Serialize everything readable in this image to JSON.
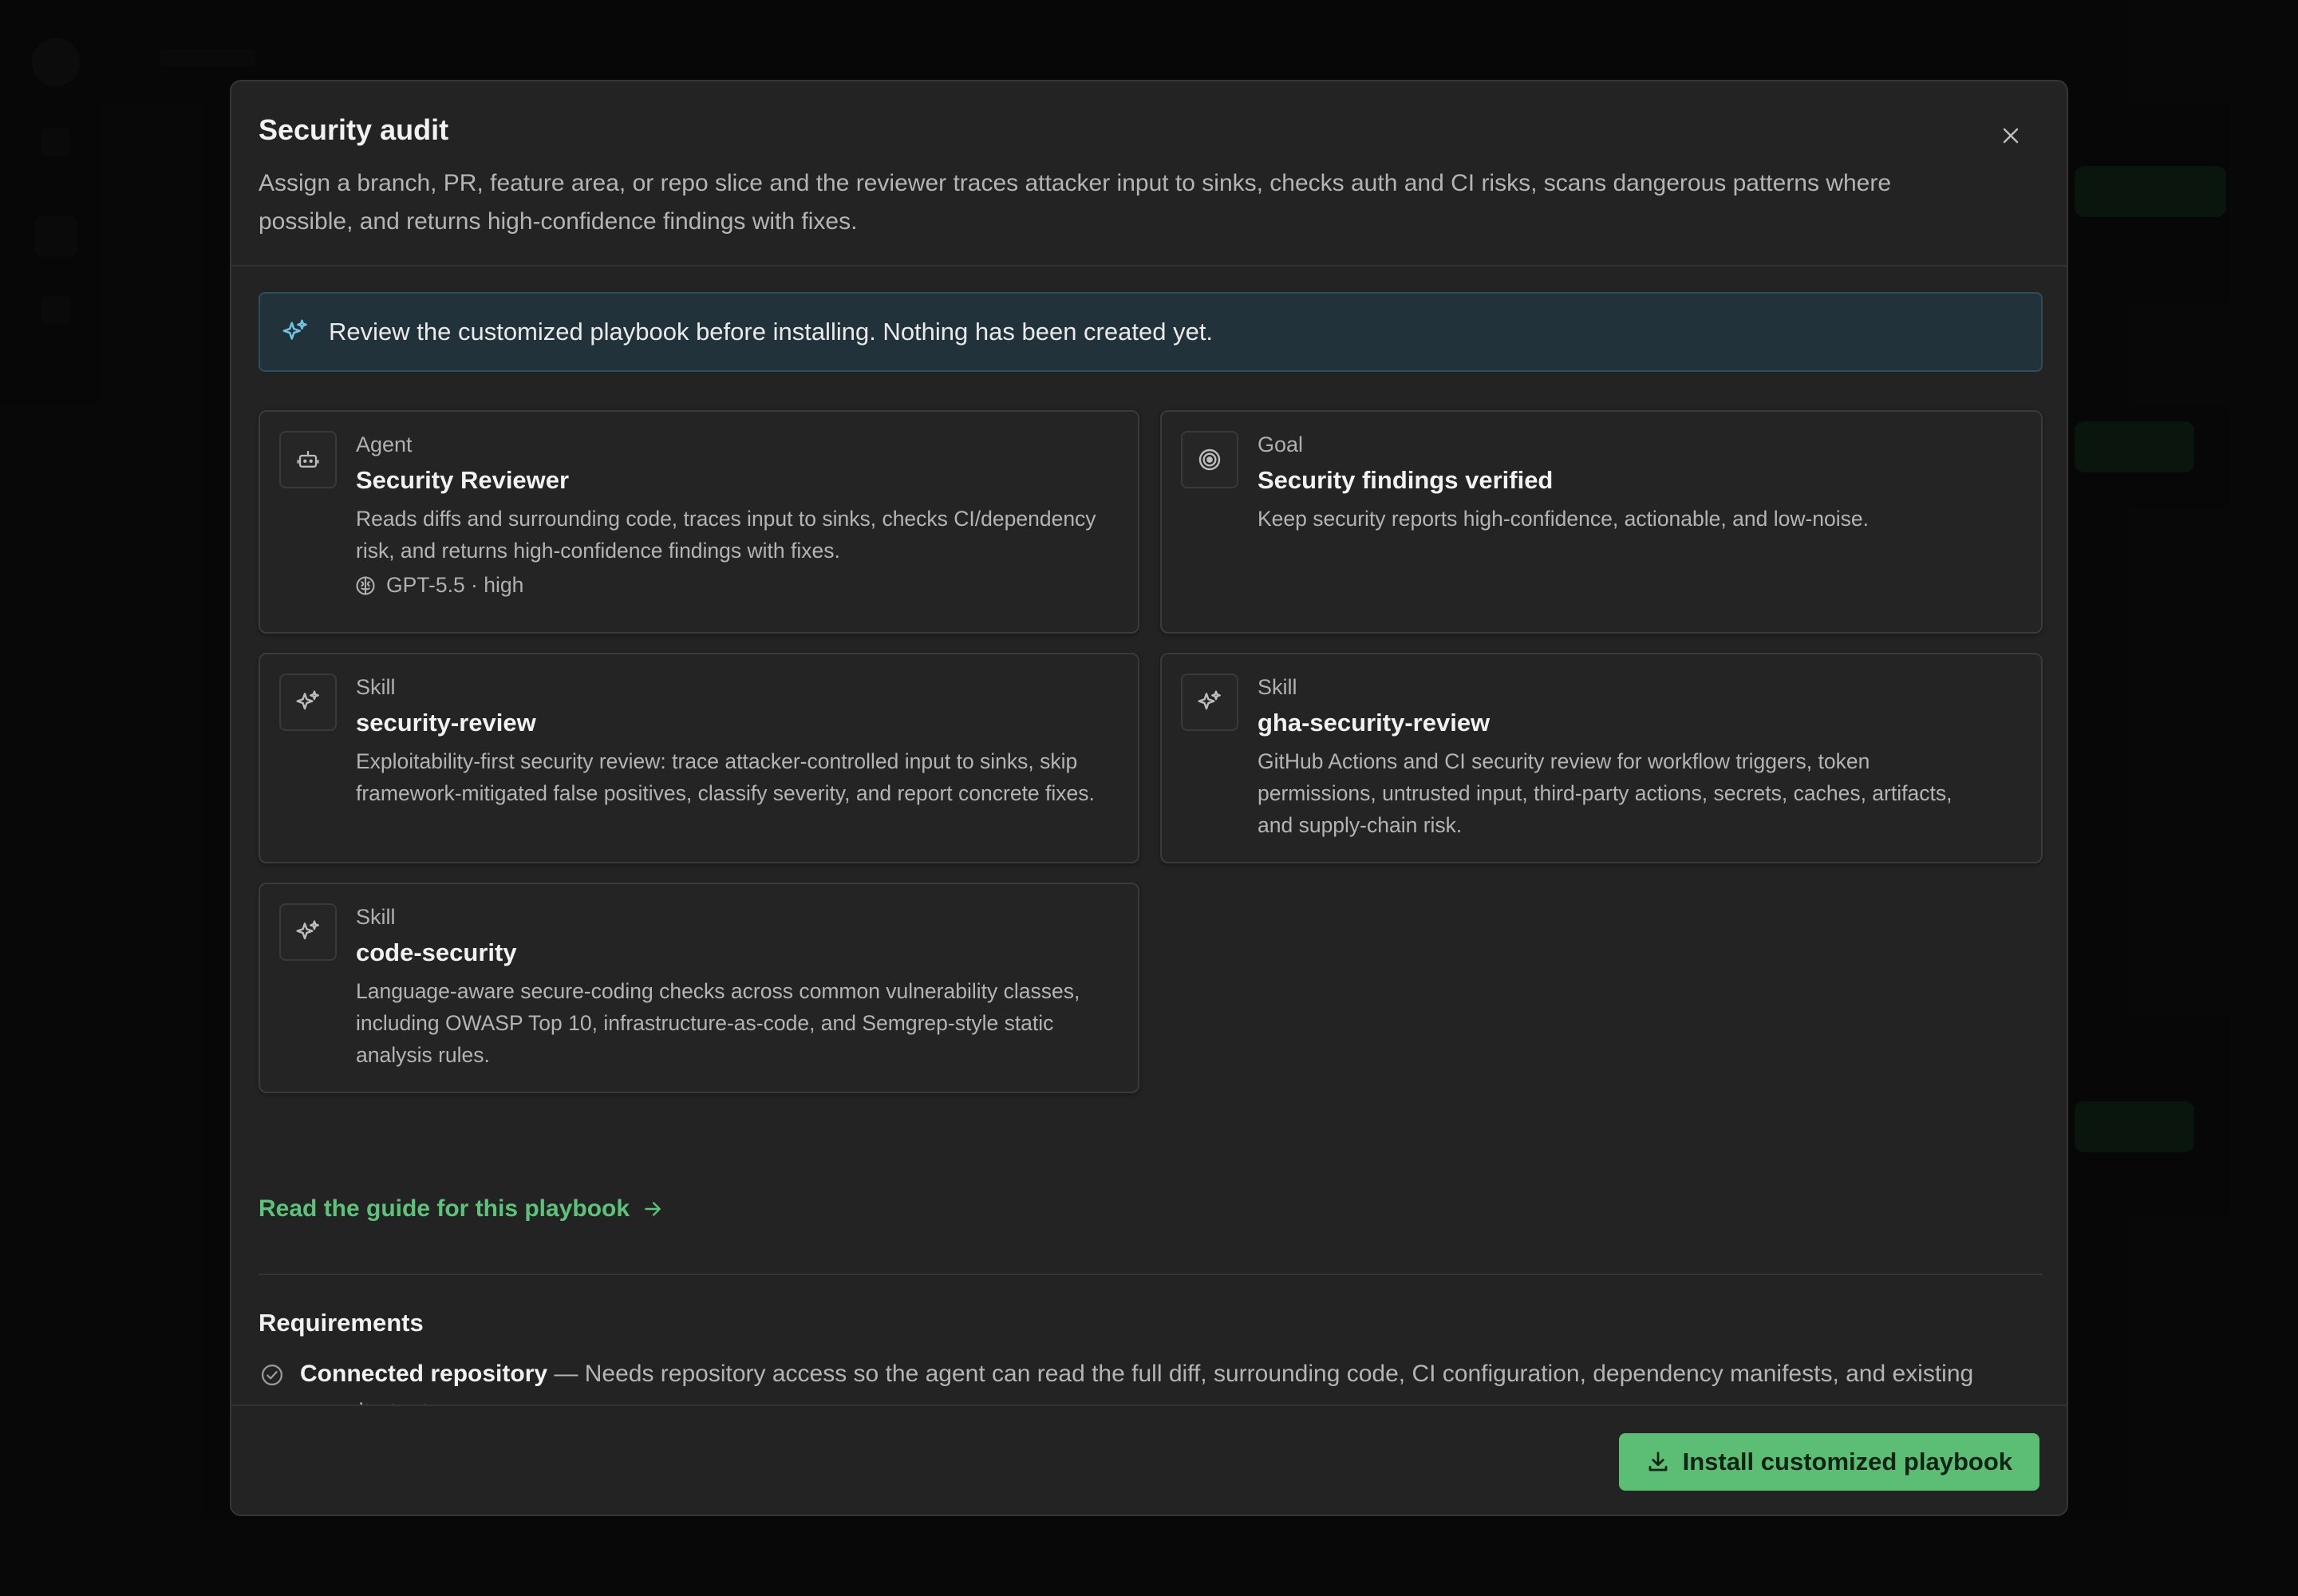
{
  "modal": {
    "title": "Security audit",
    "description": "Assign a branch, PR, feature area, or repo slice and the reviewer traces attacker input to sinks, checks auth and CI risks, scans dangerous patterns where possible, and returns high-confidence findings with fixes.",
    "close_icon": "close-icon"
  },
  "notice": {
    "icon": "sparkles-icon",
    "text": "Review the customized playbook before installing. Nothing has been created yet."
  },
  "cards": [
    {
      "kind": "Agent",
      "name": "Security Reviewer",
      "description": "Reads diffs and surrounding code, traces input to sinks, checks CI/dependency risk, and returns high-confidence findings with fixes.",
      "meta": "GPT-5.5 · high",
      "icon": "robot-icon",
      "meta_icon": "brain-icon"
    },
    {
      "kind": "Goal",
      "name": "Security findings verified",
      "description": "Keep security reports high-confidence, actionable, and low-noise.",
      "icon": "target-icon"
    },
    {
      "kind": "Skill",
      "name": "security-review",
      "description": "Exploitability-first security review: trace attacker-controlled input to sinks, skip framework-mitigated false positives, classify severity, and report concrete fixes.",
      "icon": "sparkles-icon"
    },
    {
      "kind": "Skill",
      "name": "gha-security-review",
      "description": "GitHub Actions and CI security review for workflow triggers, token permissions, untrusted input, third-party actions, secrets, caches, artifacts, and supply-chain risk.",
      "icon": "sparkles-icon"
    },
    {
      "kind": "Skill",
      "name": "code-security",
      "description": "Language-aware secure-coding checks across common vulnerability classes, including OWASP Top 10, infrastructure-as-code, and Semgrep-style static analysis rules.",
      "icon": "sparkles-icon"
    }
  ],
  "guide_link": {
    "label": "Read the guide for this playbook",
    "icon": "arrow-right-icon"
  },
  "requirements": {
    "title": "Requirements",
    "items": [
      {
        "name": "Connected repository",
        "text": " — Needs repository access so the agent can read the full diff, surrounding code, CI configuration, dependency manifests, and existing security tests.",
        "icon": "check-circle-icon"
      }
    ]
  },
  "footer": {
    "install_label": "Install customized playbook",
    "install_icon": "download-icon"
  },
  "colors": {
    "accent_green": "#5cbd74",
    "link_green": "#5cc37a",
    "notice_bg": "#21323a",
    "modal_bg": "#232323"
  }
}
